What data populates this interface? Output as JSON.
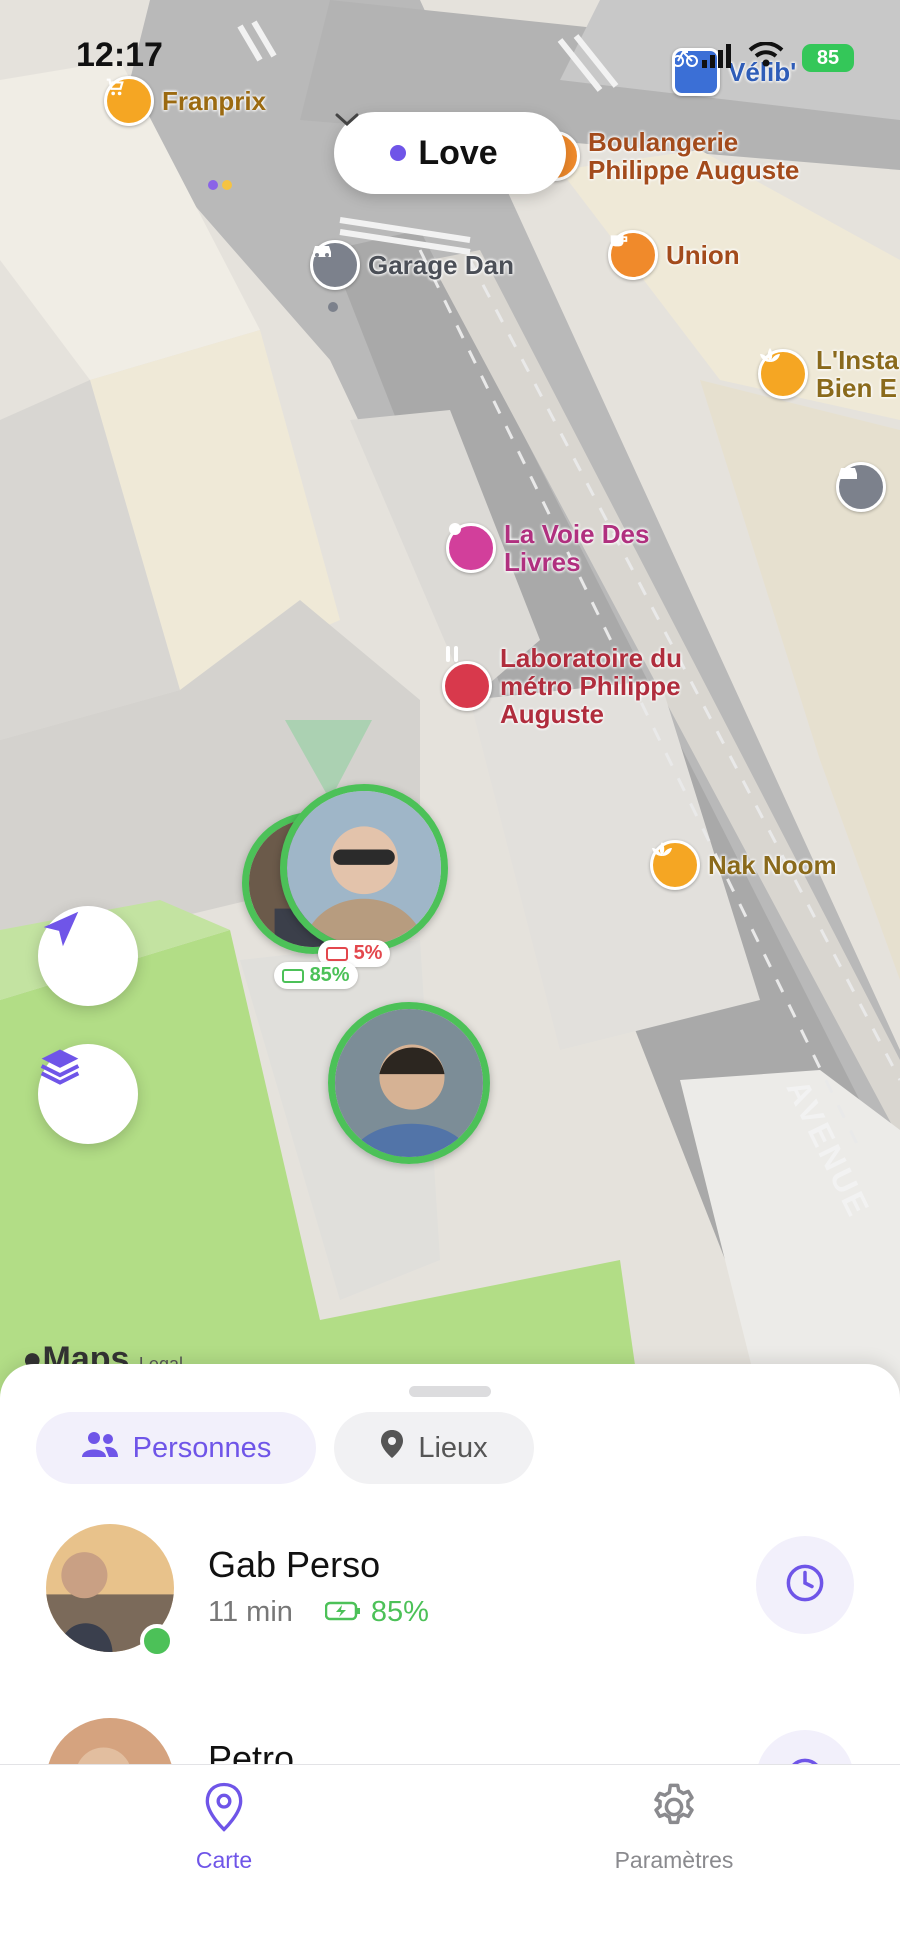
{
  "status_bar": {
    "time": "12:17",
    "battery": "85"
  },
  "colors": {
    "accent": "#6f55e8",
    "green": "#4cc158",
    "red": "#e3474d",
    "chip_bg": "#f2f0fb"
  },
  "map": {
    "group_selector": {
      "label": "Love",
      "dot_color": "#6f55e8",
      "icon": "chevron-down-icon"
    },
    "pois": [
      {
        "label": "Franprix",
        "icon": "cart-icon",
        "color": "#f5a623",
        "text_color": "#9b6a11"
      },
      {
        "label": "Vélib'",
        "icon": "bike-icon",
        "color": "#3b6fd6",
        "text_color": "#2f5db8"
      },
      {
        "label": "Boulangerie Philippe Auguste",
        "icon": "bakery-icon",
        "color": "#f08a2b",
        "text_color": "#a34b1c"
      },
      {
        "label": "Garage Dan",
        "icon": "car-icon",
        "color": "#7c818c",
        "text_color": "#4b4f57"
      },
      {
        "label": "Union",
        "icon": "coffee-icon",
        "color": "#f08a2b",
        "text_color": "#a34b1c"
      },
      {
        "label": "L'Insta Bien E",
        "icon": "lotus-icon",
        "color": "#f5a623",
        "text_color": "#8a6a1c"
      },
      {
        "label": "La Voie Des Livres",
        "icon": "circle-icon",
        "color": "#d23f9b",
        "text_color": "#b0307f"
      },
      {
        "label": "Laboratoire du métro Philippe Auguste",
        "icon": "lab-icon",
        "color": "#d8394c",
        "text_color": "#b02d3d"
      },
      {
        "label": "Nak Noom",
        "icon": "lotus-icon",
        "color": "#f5a623",
        "text_color": "#8a6a1c"
      }
    ],
    "street_label": "AVENUE",
    "attribution": "Maps",
    "attribution_suffix": "Legal",
    "people_markers": [
      {
        "battery": "5%"
      },
      {
        "battery": "85%"
      }
    ]
  },
  "sheet": {
    "segments": [
      {
        "label": "Personnes",
        "icon": "people-icon",
        "active": true
      },
      {
        "label": "Lieux",
        "icon": "pin-icon",
        "active": false
      }
    ],
    "people": [
      {
        "name": "Gab Perso",
        "time": "11 min",
        "battery": "85%",
        "online": true,
        "action_icon": "clock-icon"
      },
      {
        "name": "Petro",
        "time": "",
        "battery": "",
        "online": false,
        "action_icon": "clock-icon"
      }
    ]
  },
  "tabbar": {
    "items": [
      {
        "label": "Carte",
        "icon": "map-pin-icon",
        "active": true
      },
      {
        "label": "Paramètres",
        "icon": "gear-icon",
        "active": false
      }
    ]
  }
}
